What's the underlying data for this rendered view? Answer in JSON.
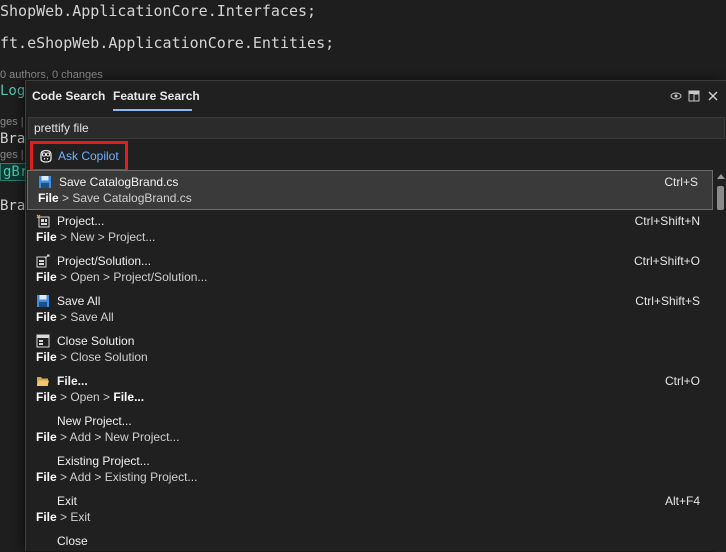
{
  "editor": {
    "line1": "ShopWeb.ApplicationCore.Interfaces;",
    "line2": "ft.eShopWeb.ApplicationCore.Entities;",
    "codelens": "0 authors, 0 changes",
    "frag_logb": "LogB",
    "frag_ges1": "ges |",
    "frag_bra": "Bra",
    "frag_ges2": "ges |",
    "frag_gbra": "gBra",
    "frag_brand": "Brand"
  },
  "popup": {
    "tabs": [
      {
        "label": "Code Search"
      },
      {
        "label": "Feature Search"
      }
    ],
    "search": {
      "value": "prettify file"
    },
    "copilot": {
      "label": "Ask Copilot"
    },
    "results": [
      {
        "title": "Save CatalogBrand.cs",
        "path_root": "File",
        "path_rest": " > Save CatalogBrand.cs",
        "path_bold_tail": "",
        "shortcut": "Ctrl+S",
        "icon": "save-icon",
        "selected": true
      },
      {
        "title": "Project...",
        "path_root": "File",
        "path_rest": " > New > Project...",
        "path_bold_tail": "",
        "shortcut": "Ctrl+Shift+N",
        "icon": "new-project-icon"
      },
      {
        "title": "Project/Solution...",
        "path_root": "File",
        "path_rest": " > Open > Project/Solution...",
        "path_bold_tail": "",
        "shortcut": "Ctrl+Shift+O",
        "icon": "open-project-icon"
      },
      {
        "title": "Save All",
        "path_root": "File",
        "path_rest": " > Save All",
        "path_bold_tail": "",
        "shortcut": "Ctrl+Shift+S",
        "icon": "save-all-icon"
      },
      {
        "title": "Close Solution",
        "path_root": "File",
        "path_rest": " > Close Solution",
        "path_bold_tail": "",
        "shortcut": "",
        "icon": "close-solution-icon"
      },
      {
        "title": "File...",
        "path_root": "File",
        "path_rest": " > Open > ",
        "path_bold_tail": "File...",
        "shortcut": "Ctrl+O",
        "icon": "open-file-icon",
        "title_bold_prefix": "File"
      },
      {
        "title": "New Project...",
        "path_root": "File",
        "path_rest": " > Add > New Project...",
        "path_bold_tail": "",
        "shortcut": "",
        "icon": ""
      },
      {
        "title": "Existing Project...",
        "path_root": "File",
        "path_rest": " > Add > Existing Project...",
        "path_bold_tail": "",
        "shortcut": "",
        "icon": ""
      },
      {
        "title": "Exit",
        "path_root": "File",
        "path_rest": " > Exit",
        "path_bold_tail": "",
        "shortcut": "Alt+F4",
        "icon": ""
      },
      {
        "title": "Close",
        "path_root": "",
        "path_rest": "",
        "path_bold_tail": "",
        "shortcut": "",
        "icon": ""
      }
    ],
    "colors": {
      "accent_link": "#6fb2ff",
      "highlight_border": "#e31c1c",
      "tab_underline": "#8fb8f0"
    }
  }
}
